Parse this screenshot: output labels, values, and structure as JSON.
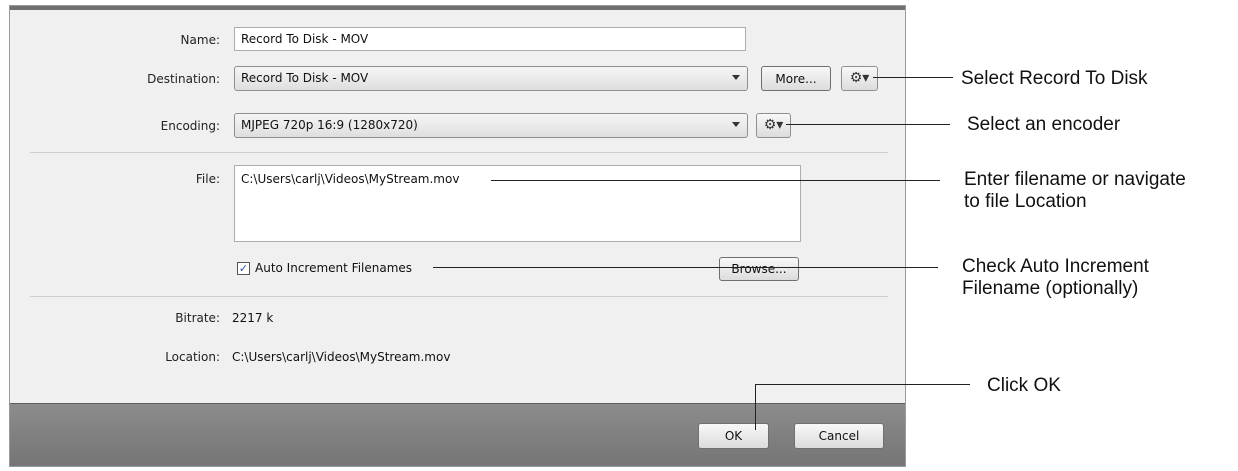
{
  "form": {
    "name_label": "Name:",
    "name_value": "Record To Disk - MOV",
    "destination_label": "Destination:",
    "destination_value": "Record To Disk - MOV",
    "more_button": "More...",
    "encoding_label": "Encoding:",
    "encoding_value": "MJPEG 720p 16:9 (1280x720)",
    "file_label": "File:",
    "file_value": "C:\\Users\\carlj\\Videos\\MyStream.mov",
    "auto_increment_label": "Auto Increment Filenames",
    "auto_increment_checked": true,
    "browse_button": "Browse...",
    "bitrate_label": "Bitrate:",
    "bitrate_value": "2217 k",
    "location_label": "Location:",
    "location_value": "C:\\Users\\carlj\\Videos\\MyStream.mov"
  },
  "footer": {
    "ok_button": "OK",
    "cancel_button": "Cancel"
  },
  "icons": {
    "settings": "gear-icon",
    "dropdown": "chevron-down-icon",
    "check": "checkmark-icon"
  },
  "callouts": {
    "destination": "Select Record To Disk",
    "encoder": "Select an encoder",
    "file_line1": "Enter filename or navigate",
    "file_line2": "to file Location",
    "auto_line1": "Check Auto Increment",
    "auto_line2": "Filename (optionally)",
    "ok": "Click OK"
  },
  "colors": {
    "dialog_bg": "#f0f0f0",
    "footer_bg": "#808080",
    "checkbox_accent": "#2a4fa0"
  }
}
